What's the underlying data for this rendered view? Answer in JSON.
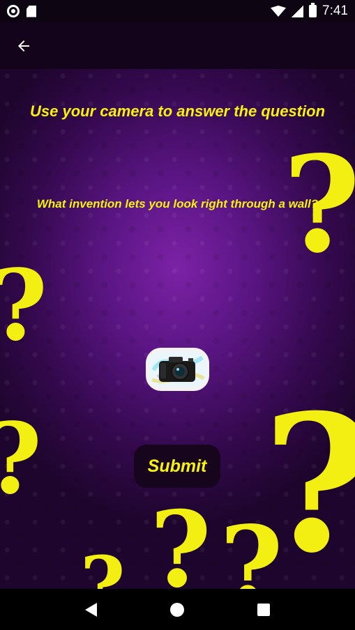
{
  "status_bar": {
    "time": "7:41",
    "icons": [
      "record-icon",
      "sd-card-icon",
      "wifi-icon",
      "signal-icon",
      "battery-icon"
    ]
  },
  "app_bar": {
    "back_icon": "arrow-left-icon"
  },
  "main": {
    "heading": "Use your camera to answer the question",
    "question": "What invention lets you look right through a wall?",
    "camera_icon": "camera-icon",
    "submit_label": "Submit",
    "decoration_glyph": "?"
  },
  "nav_bar": {
    "icons": [
      "back-triangle-icon",
      "home-circle-icon",
      "recents-square-icon"
    ]
  },
  "colors": {
    "accent_yellow": "#f6f10e",
    "background_purple": "#5a1583",
    "button_dark": "#16051c"
  }
}
